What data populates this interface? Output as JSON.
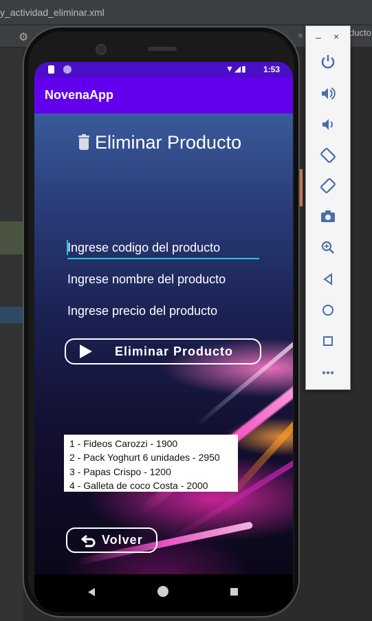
{
  "ide": {
    "title": "y_actividad_eliminar.xml",
    "right_tab": "ducto"
  },
  "app": {
    "status_time": "1:53",
    "status_icons": "▼◢▮",
    "app_title": "NovenaApp",
    "screen_title": "Eliminar Producto",
    "fields": {
      "codigo_hint": "Ingrese codigo del producto",
      "nombre_hint": "Ingrese nombre del producto",
      "precio_hint": "Ingrese precio del producto"
    },
    "eliminar_label": "Eliminar Producto",
    "products": [
      "1 - Fideos Carozzi - 1900",
      "2 - Pack Yoghurt 6 unidades - 2950",
      "3 - Papas Crispo - 1200",
      "4 - Galleta de coco Costa - 2000"
    ],
    "volver_label": "Volver"
  },
  "emulator": {
    "minimize": "–",
    "close": "×",
    "buttons": [
      "power-icon",
      "volume-up-icon",
      "volume-down-icon",
      "rotate-left-icon",
      "rotate-right-icon",
      "camera-icon",
      "zoom-icon",
      "back-icon",
      "home-icon",
      "overview-icon",
      "more-icon"
    ]
  },
  "colors": {
    "app_bar": "#6200ee",
    "status_bar": "#4b0fc6",
    "field_accent": "#26c6da",
    "emulator_icon": "#4a6ea8"
  }
}
